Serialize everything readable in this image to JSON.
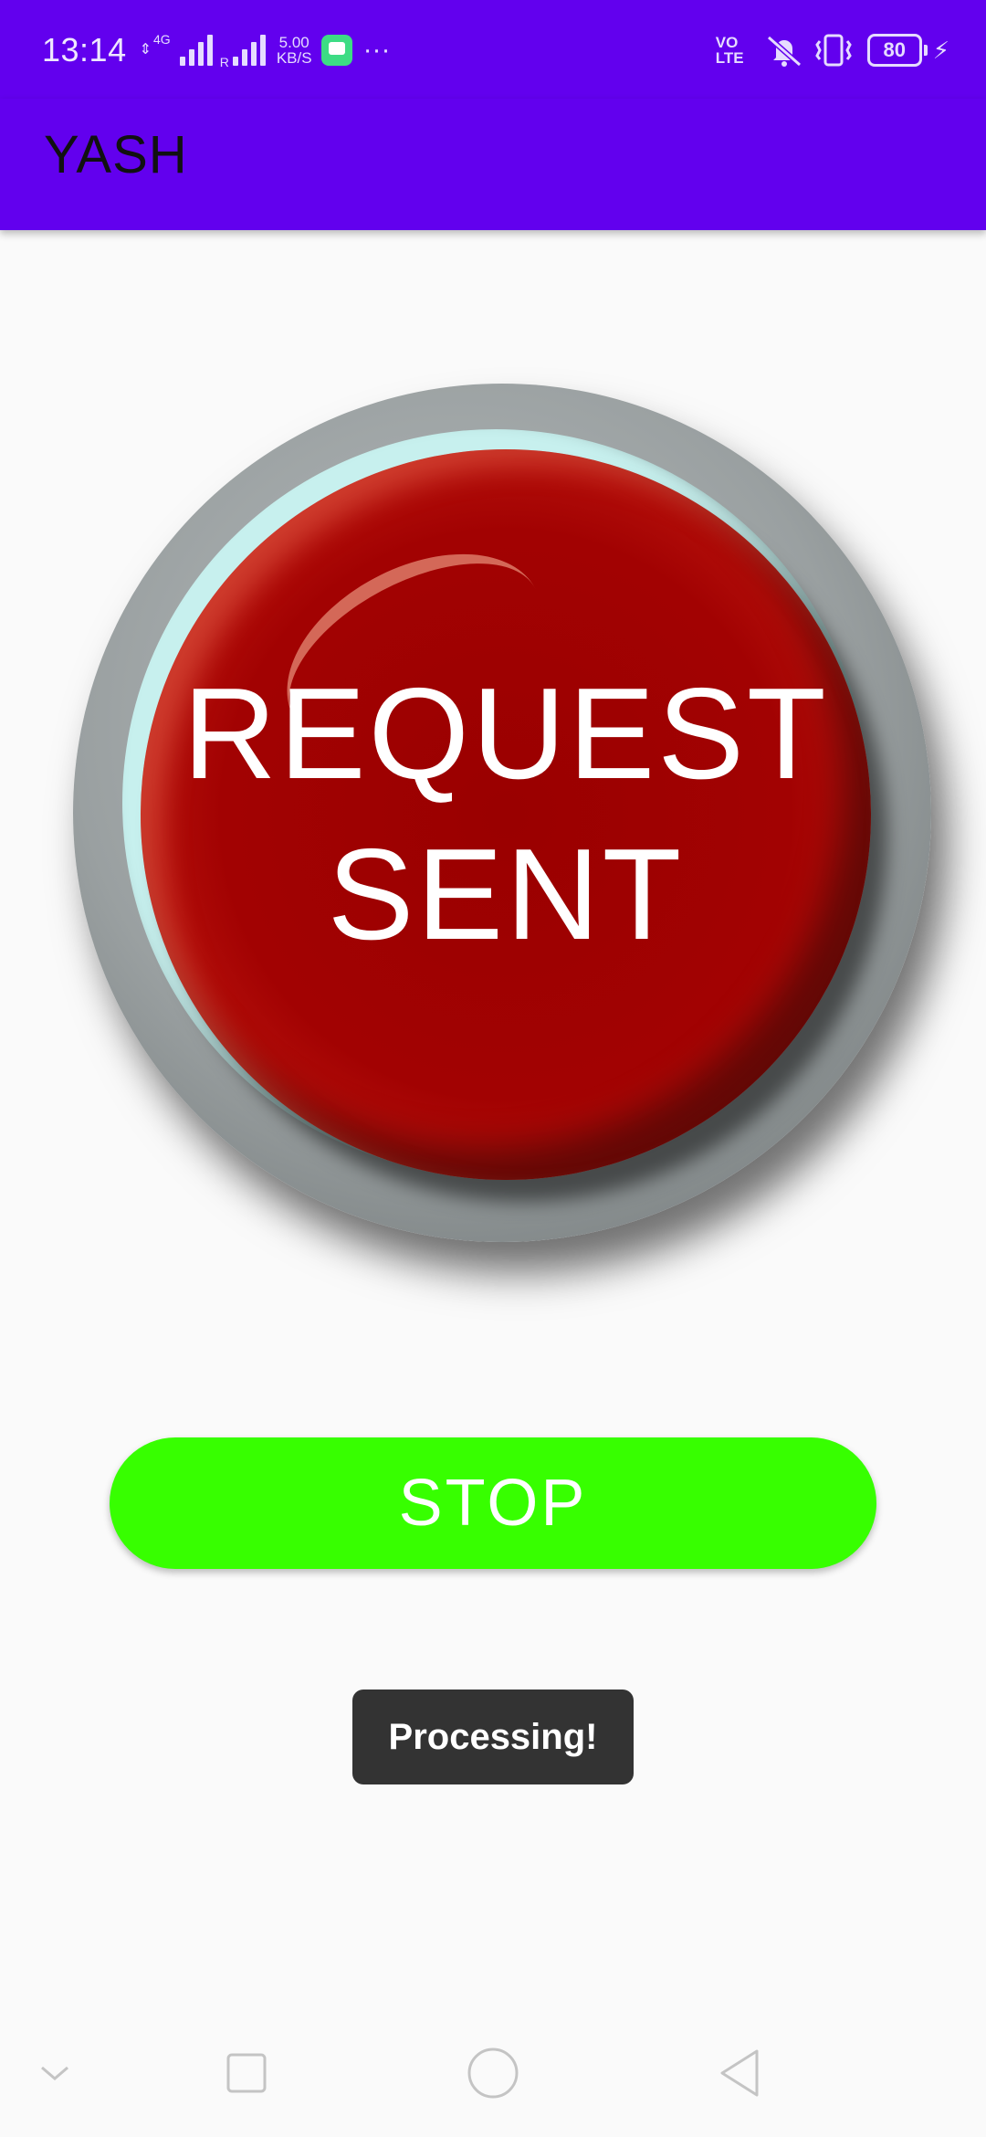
{
  "status_bar": {
    "time": "13:14",
    "network_type": "4G",
    "roaming": "R",
    "speed_value": "5.00",
    "speed_unit": "KB/S",
    "more": "···",
    "volte": "VO LTE",
    "battery_level": "80",
    "icons": [
      "data-arrows-icon",
      "signal-icon",
      "message-app-icon",
      "vibrate-mute-icon",
      "vibrate-icon",
      "battery-icon",
      "charging-icon"
    ]
  },
  "app_bar": {
    "title": "YASH",
    "color": "#6200ee"
  },
  "main": {
    "big_button": {
      "line1": "REQUEST",
      "line2": "SENT",
      "color": "#a20202"
    },
    "stop_button": {
      "label": "STOP",
      "color": "#37ff00"
    }
  },
  "toast": {
    "text": "Processing!"
  },
  "nav_bar": {
    "items": [
      "chevron-down-icon",
      "recents-icon",
      "home-icon",
      "back-icon"
    ]
  }
}
